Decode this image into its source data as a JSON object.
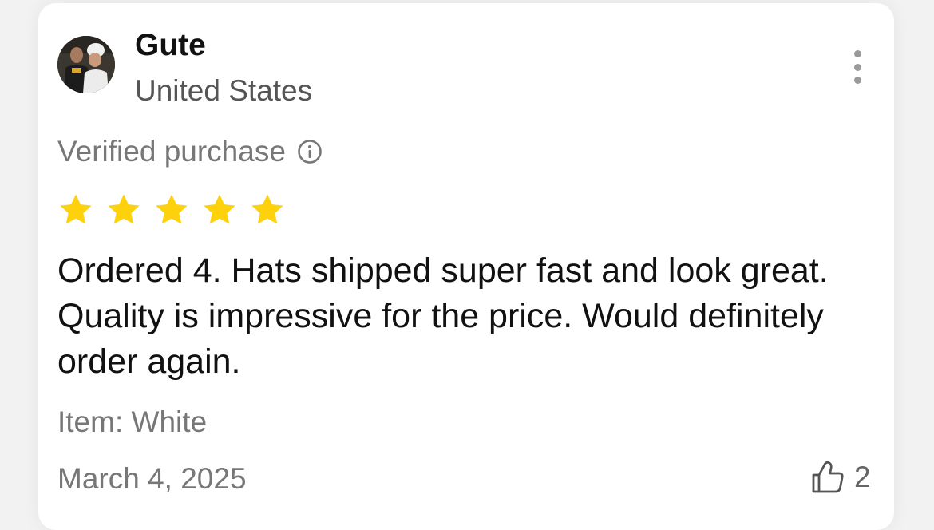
{
  "review": {
    "reviewer": {
      "name": "Gute",
      "country": "United States",
      "avatar_icon": "user-photo-avatar"
    },
    "verified_label": "Verified purchase",
    "rating": {
      "value": 5,
      "max": 5,
      "star_color": "#fdd10c"
    },
    "body": "Ordered 4. Hats shipped super fast and look great. Quality is impressive for the price. Would definitely order again.",
    "item_variant": "Item: White",
    "date": "March 4, 2025",
    "helpful": {
      "icon": "thumbs-up-icon",
      "count": "2"
    },
    "menu_icon": "more-vertical-icon"
  },
  "colors": {
    "background": "#f2f2f2",
    "card": "#ffffff",
    "primary_text": "#111111",
    "secondary_text": "#777777"
  }
}
